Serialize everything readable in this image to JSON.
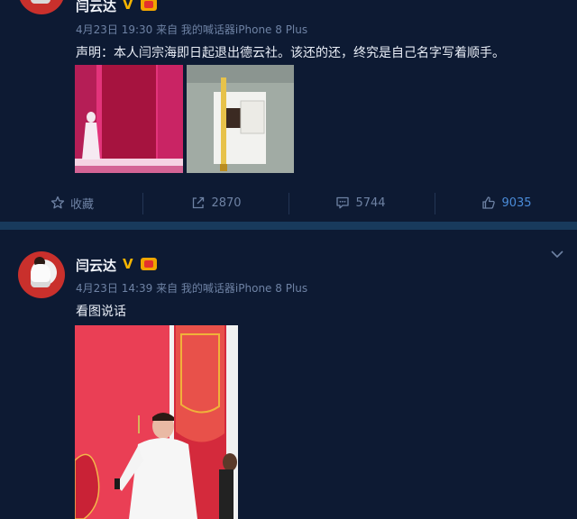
{
  "posts": [
    {
      "author": "闫云达",
      "verified_badge": "V",
      "meta": "4月23日 19:30 来自 我的喊话器iPhone 8 Plus",
      "text": "声明：本人闫宗海即日起退出德云社。该还的还，终究是自己名字写着顺手。",
      "actions": {
        "favorite_label": "收藏",
        "repost_count": "2870",
        "comment_count": "5744",
        "like_count": "9035"
      }
    },
    {
      "author": "闫云达",
      "verified_badge": "V",
      "meta": "4月23日 14:39 来自 我的喊话器iPhone 8 Plus",
      "text": "看图说话"
    }
  ],
  "colors": {
    "background": "#0d1a33",
    "meta_text": "#6e82a4",
    "like_active": "#4a8bd8",
    "verified_gold": "#f5b400"
  },
  "icons": {
    "favorite": "star-icon",
    "repost": "share-icon",
    "comment": "comment-icon",
    "like": "thumbs-up-icon",
    "more": "chevron-down-icon"
  }
}
